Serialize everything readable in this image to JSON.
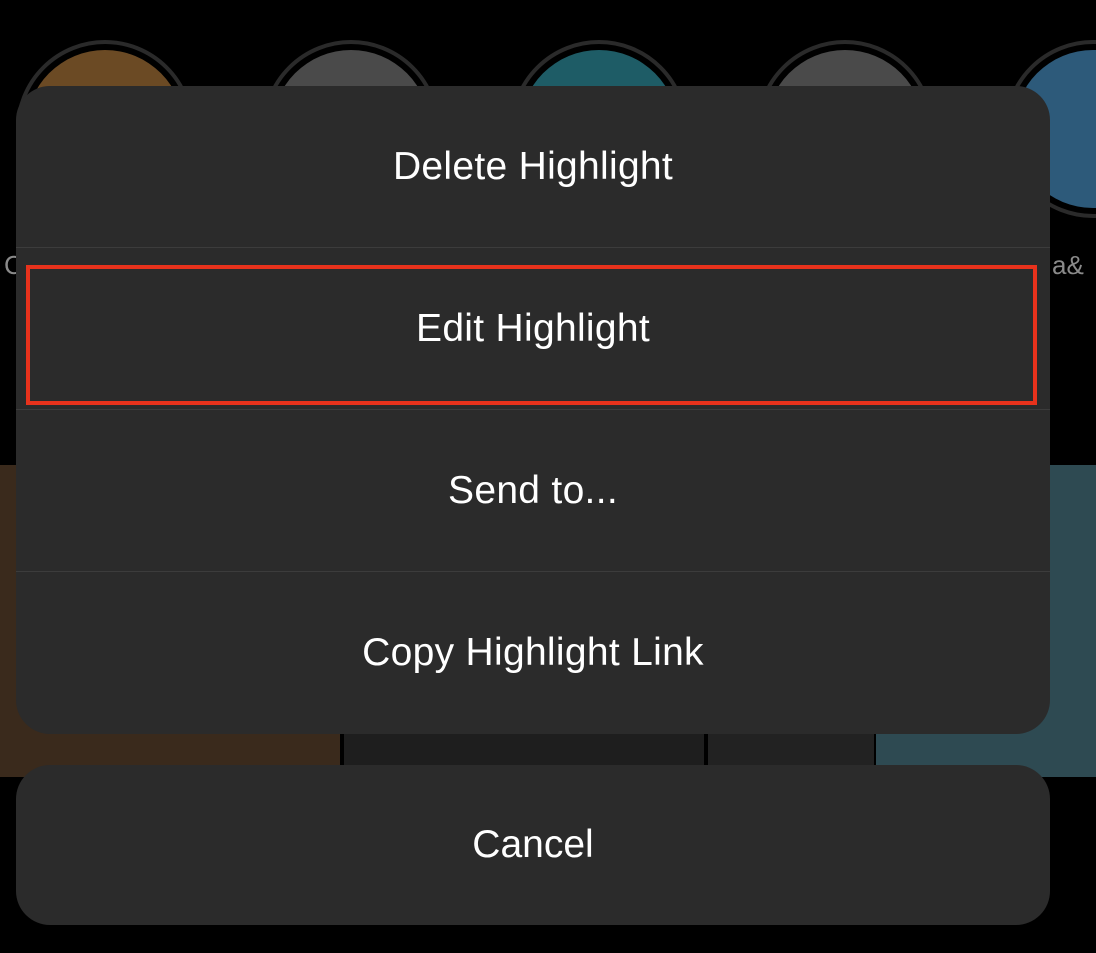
{
  "background": {
    "left_label": "C",
    "right_label": "a&"
  },
  "sheet": {
    "items": [
      {
        "label": "Delete Highlight"
      },
      {
        "label": "Edit Highlight"
      },
      {
        "label": "Send to..."
      },
      {
        "label": "Copy Highlight Link"
      }
    ],
    "selected_index": 1
  },
  "cancel": {
    "label": "Cancel"
  },
  "colors": {
    "sheet_bg": "#2b2b2b",
    "text": "#ffffff",
    "divider": "#3c3c3c",
    "selection_outline": "#e8321c",
    "backdrop": "#000000"
  }
}
